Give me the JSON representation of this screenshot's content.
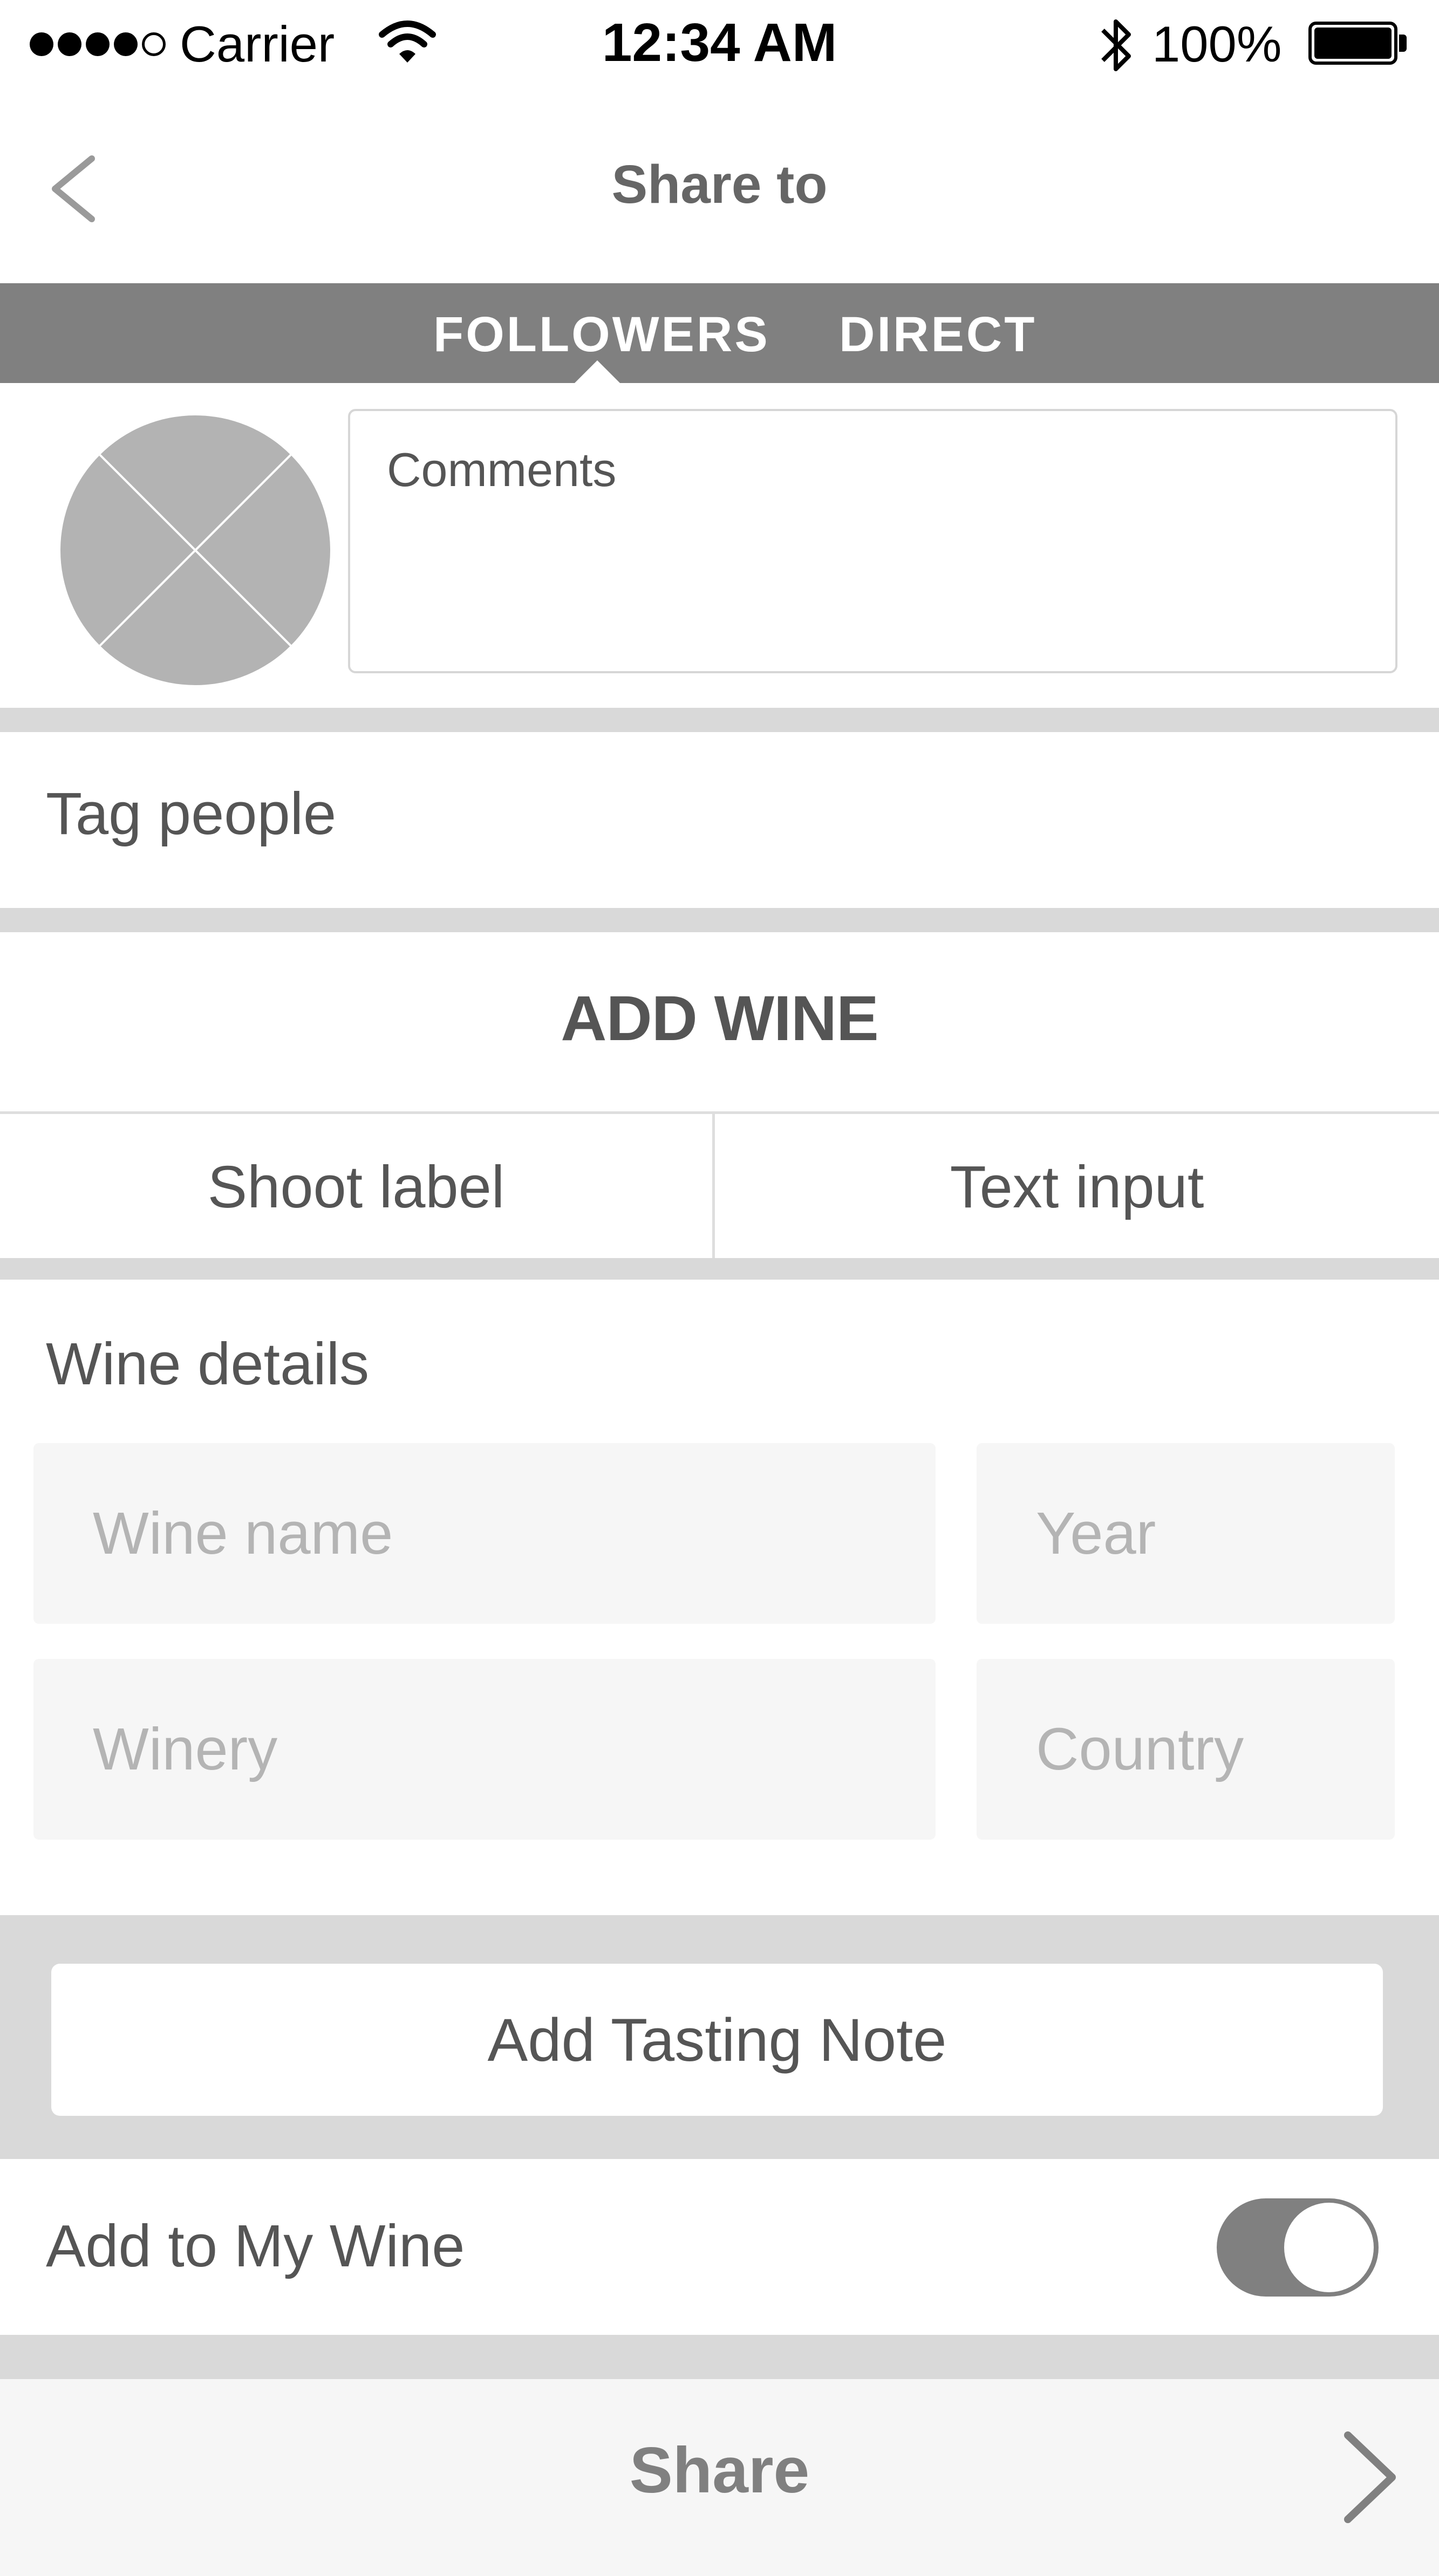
{
  "status_bar": {
    "carrier": "Carrier",
    "time": "12:34 AM",
    "battery_percent": "100%"
  },
  "nav": {
    "title": "Share to"
  },
  "tabs": [
    {
      "label": "FOLLOWERS",
      "selected": true
    },
    {
      "label": "DIRECT",
      "selected": false
    }
  ],
  "comments": {
    "placeholder": "Comments"
  },
  "tag_people": {
    "label": "Tag people"
  },
  "add_wine": {
    "heading": "ADD WINE",
    "options": [
      "Shoot label",
      "Text input"
    ]
  },
  "wine_details": {
    "heading": "Wine details",
    "fields": {
      "wine_name": "Wine name",
      "year": "Year",
      "winery": "Winery",
      "country": "Country"
    }
  },
  "tasting": {
    "button_label": "Add Tasting Note"
  },
  "my_wine": {
    "label": "Add to My Wine",
    "toggle_on": true
  },
  "share": {
    "label": "Share"
  },
  "colors": {
    "tab_bar": "#808080",
    "separator": "#d9d9d9",
    "field_bg": "#f6f6f6",
    "avatar": "#b3b3b3",
    "text": "#555555"
  }
}
